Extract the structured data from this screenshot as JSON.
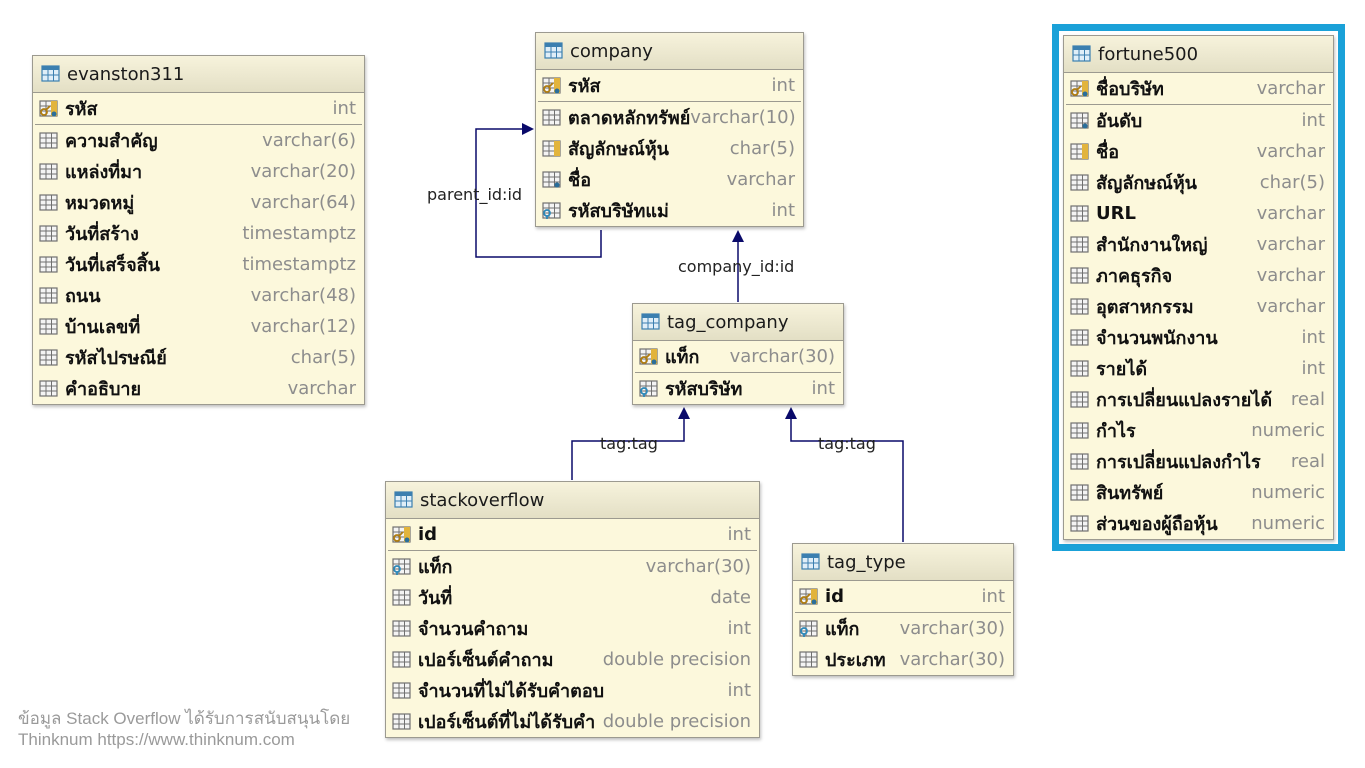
{
  "colors": {
    "table_bg": "#fcf8dc",
    "header_bg": "#e8e4ca",
    "edge": "#0a0a6a",
    "highlight": "#1aa1d8"
  },
  "tables": {
    "evanston311": {
      "name": "evanston311",
      "pk": [
        {
          "name": "รหัส",
          "type": "int",
          "icon": "pk-key-icon"
        }
      ],
      "cols": [
        {
          "name": "ความสำคัญ",
          "type": "varchar(6)",
          "icon": "column-icon"
        },
        {
          "name": "แหล่งที่มา",
          "type": "varchar(20)",
          "icon": "column-icon"
        },
        {
          "name": "หมวดหมู่",
          "type": "varchar(64)",
          "icon": "column-icon"
        },
        {
          "name": "วันที่สร้าง",
          "type": "timestamptz",
          "icon": "column-icon"
        },
        {
          "name": "วันที่เสร็จสิ้น",
          "type": "timestamptz",
          "icon": "column-icon"
        },
        {
          "name": "ถนน",
          "type": "varchar(48)",
          "icon": "column-icon"
        },
        {
          "name": "บ้านเลขที่",
          "type": "varchar(12)",
          "icon": "column-icon"
        },
        {
          "name": "รหัสไปรษณีย์",
          "type": "char(5)",
          "icon": "column-icon"
        },
        {
          "name": "คำอธิบาย",
          "type": "varchar",
          "icon": "column-icon"
        }
      ]
    },
    "company": {
      "name": "company",
      "pk": [
        {
          "name": "รหัส",
          "type": "int",
          "icon": "pk-key-icon"
        }
      ],
      "cols": [
        {
          "name": "ตลาดหลักทรัพย์",
          "type": "varchar(10)",
          "icon": "column-icon"
        },
        {
          "name": "สัญลักษณ์หุ้น",
          "type": "char(5)",
          "icon": "unique-column-icon"
        },
        {
          "name": "ชื่อ",
          "type": "varchar",
          "icon": "notnull-column-icon"
        },
        {
          "name": "รหัสบริษัทแม่",
          "type": "int",
          "icon": "fk-key-icon"
        }
      ]
    },
    "tag_company": {
      "name": "tag_company",
      "pk": [
        {
          "name": "แท็ก",
          "type": "varchar(30)",
          "icon": "pk-key-icon"
        }
      ],
      "cols": [
        {
          "name": "รหัสบริษัท",
          "type": "int",
          "icon": "fk-key-icon"
        }
      ]
    },
    "stackoverflow": {
      "name": "stackoverflow",
      "pk": [
        {
          "name": "id",
          "type": "int",
          "icon": "pk-key-icon"
        }
      ],
      "cols": [
        {
          "name": "แท็ก",
          "type": "varchar(30)",
          "icon": "fk-key-icon"
        },
        {
          "name": "วันที่",
          "type": "date",
          "icon": "column-icon"
        },
        {
          "name": "จำนวนคำถาม",
          "type": "int",
          "icon": "column-icon"
        },
        {
          "name": "เปอร์เซ็นต์คำถาม",
          "type": "double precision",
          "icon": "column-icon"
        },
        {
          "name": "จำนวนที่ไม่ได้รับคำตอบ",
          "type": "int",
          "icon": "column-icon"
        },
        {
          "name": "เปอร์เซ็นต์ที่ไม่ได้รับคำ",
          "type": "double precision",
          "icon": "column-icon"
        }
      ]
    },
    "tag_type": {
      "name": "tag_type",
      "pk": [
        {
          "name": "id",
          "type": "int",
          "icon": "pk-key-icon"
        }
      ],
      "cols": [
        {
          "name": "แท็ก",
          "type": "varchar(30)",
          "icon": "fk-key-icon"
        },
        {
          "name": "ประเภท",
          "type": "varchar(30)",
          "icon": "column-icon"
        }
      ]
    },
    "fortune500": {
      "name": "fortune500",
      "pk": [
        {
          "name": "ชื่อบริษัท",
          "type": "varchar",
          "icon": "pk-key-icon"
        }
      ],
      "cols": [
        {
          "name": "อันดับ",
          "type": "int",
          "icon": "notnull-column-icon"
        },
        {
          "name": "ชื่อ",
          "type": "varchar",
          "icon": "unique-column-icon"
        },
        {
          "name": "สัญลักษณ์หุ้น",
          "type": "char(5)",
          "icon": "column-icon"
        },
        {
          "name": "URL",
          "type": "varchar",
          "icon": "column-icon"
        },
        {
          "name": "สำนักงานใหญ่",
          "type": "varchar",
          "icon": "column-icon"
        },
        {
          "name": "ภาคธุรกิจ",
          "type": "varchar",
          "icon": "column-icon"
        },
        {
          "name": "อุตสาหกรรม",
          "type": "varchar",
          "icon": "column-icon"
        },
        {
          "name": "จำนวนพนักงาน",
          "type": "int",
          "icon": "column-icon"
        },
        {
          "name": "รายได้",
          "type": "int",
          "icon": "column-icon"
        },
        {
          "name": "การเปลี่ยนแปลงรายได้",
          "type": "real",
          "icon": "column-icon"
        },
        {
          "name": "กำไร",
          "type": "numeric",
          "icon": "column-icon"
        },
        {
          "name": "การเปลี่ยนแปลงกำไร",
          "type": "real",
          "icon": "column-icon"
        },
        {
          "name": "สินทรัพย์",
          "type": "numeric",
          "icon": "column-icon"
        },
        {
          "name": "ส่วนของผู้ถือหุ้น",
          "type": "numeric",
          "icon": "column-icon"
        }
      ]
    }
  },
  "edges": {
    "parent": "parent_id:id",
    "company": "company_id:id",
    "tag1": "tag:tag",
    "tag2": "tag:tag"
  },
  "footer": {
    "line1": "ข้อมูล Stack Overflow ได้รับการสนับสนุนโดย",
    "line2": "Thinknum https://www.thinknum.com"
  }
}
